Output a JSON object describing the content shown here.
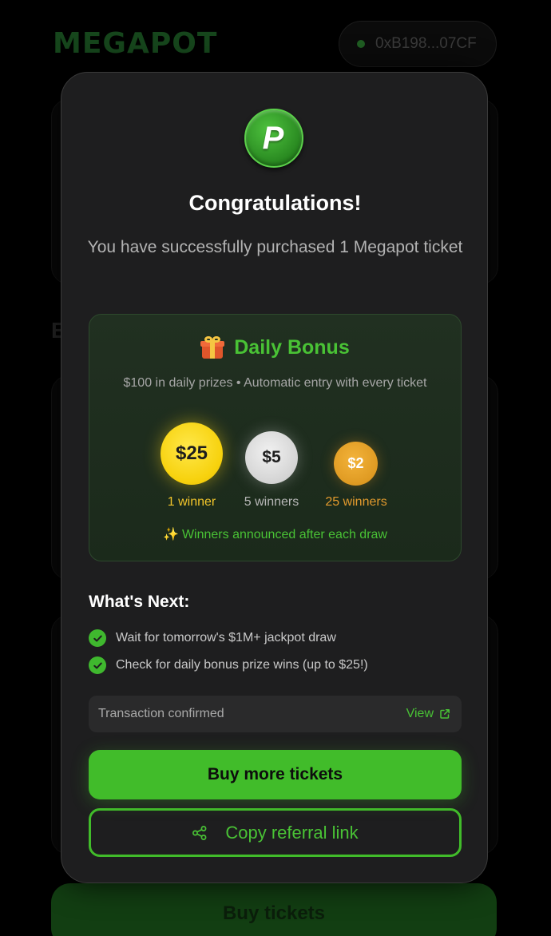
{
  "background": {
    "logo_text": "MEGAPOT",
    "wallet_address": "0xB198...07CF",
    "section_letter": "E",
    "buy_button_label": "Buy tickets"
  },
  "modal": {
    "logo_letter": "P",
    "title": "Congratulations!",
    "subtitle": "You have successfully purchased 1 Megapot ticket",
    "daily_bonus": {
      "title": "Daily Bonus",
      "description": "$100 in daily prizes • Automatic entry with every ticket",
      "prizes": [
        {
          "amount": "$25",
          "winners": "1 winner",
          "tier": "gold"
        },
        {
          "amount": "$5",
          "winners": "5 winners",
          "tier": "silver"
        },
        {
          "amount": "$2",
          "winners": "25 winners",
          "tier": "bronze"
        }
      ],
      "announcement_icon": "✨",
      "announcement": "Winners announced after each draw"
    },
    "whats_next": {
      "title": "What's Next:",
      "items": [
        "Wait for tomorrow's $1M+ jackpot draw",
        "Check for daily bonus prize wins (up to $25!)"
      ]
    },
    "transaction": {
      "label": "Transaction confirmed",
      "view_label": "View"
    },
    "buy_more_label": "Buy more tickets",
    "copy_referral_label": "Copy referral link"
  },
  "colors": {
    "accent_green": "#41bc2a",
    "gold": "#f7d20e",
    "silver": "#d4d4d4",
    "bronze": "#df9a22",
    "modal_bg": "#1e1e1f"
  },
  "icons": {
    "gift": "gift-icon",
    "check": "check-circle-icon",
    "external_link": "external-link-icon",
    "share": "share-icon"
  }
}
